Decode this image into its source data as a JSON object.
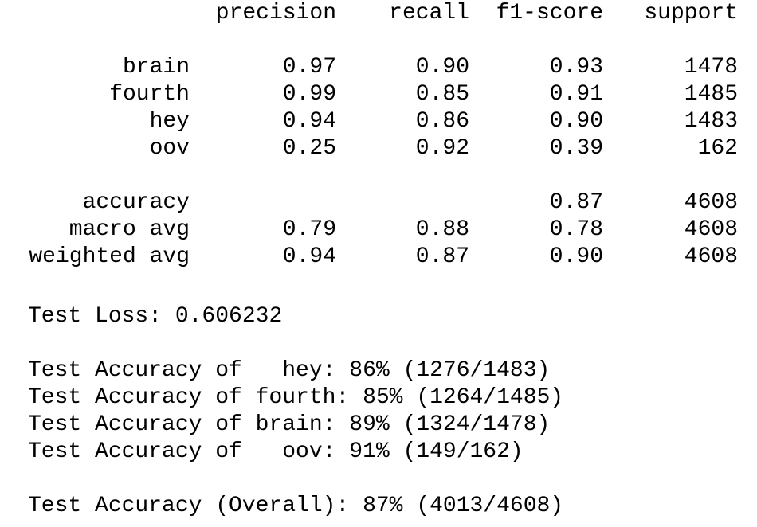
{
  "report": {
    "headers": [
      "precision",
      "recall",
      "f1-score",
      "support"
    ],
    "class_rows": [
      {
        "label": "brain",
        "precision": "0.97",
        "recall": "0.90",
        "f1": "0.93",
        "support": "1478"
      },
      {
        "label": "fourth",
        "precision": "0.99",
        "recall": "0.85",
        "f1": "0.91",
        "support": "1485"
      },
      {
        "label": "hey",
        "precision": "0.94",
        "recall": "0.86",
        "f1": "0.90",
        "support": "1483"
      },
      {
        "label": "oov",
        "precision": "0.25",
        "recall": "0.92",
        "f1": "0.39",
        "support": "162"
      }
    ],
    "summary_rows": [
      {
        "label": "accuracy",
        "precision": "",
        "recall": "",
        "f1": "0.87",
        "support": "4608"
      },
      {
        "label": "macro avg",
        "precision": "0.79",
        "recall": "0.88",
        "f1": "0.78",
        "support": "4608"
      },
      {
        "label": "weighted avg",
        "precision": "0.94",
        "recall": "0.87",
        "f1": "0.90",
        "support": "4608"
      }
    ]
  },
  "test_loss": "Test Loss: 0.606232",
  "per_class_accuracy": [
    "Test Accuracy of   hey: 86% (1276/1483)",
    "Test Accuracy of fourth: 85% (1264/1485)",
    "Test Accuracy of brain: 89% (1324/1478)",
    "Test Accuracy of   oov: 91% (149/162)"
  ],
  "overall_accuracy": "Test Accuracy (Overall): 87% (4013/4608)"
}
